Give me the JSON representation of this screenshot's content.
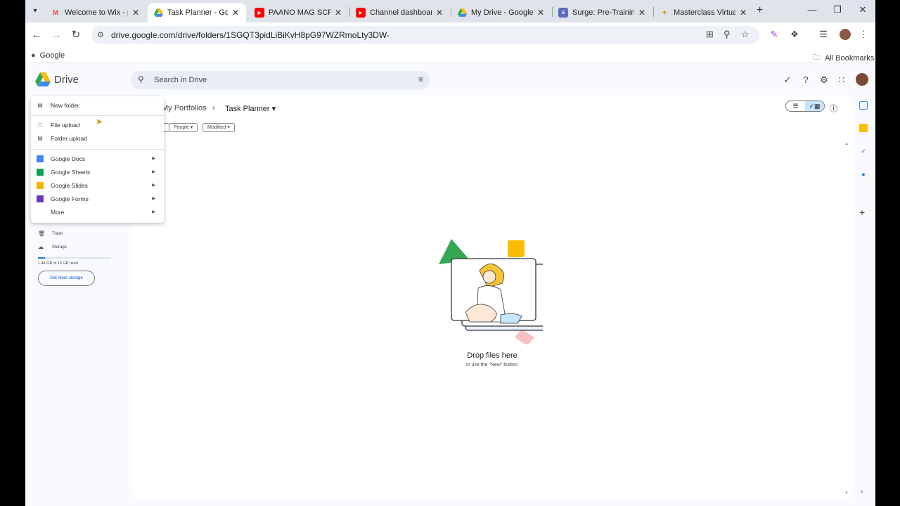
{
  "browser": {
    "tabs": [
      {
        "title": "Welcome to Wix - p",
        "favicon": "gmail-icon"
      },
      {
        "title": "Task Planner - Goog",
        "favicon": "drive-icon",
        "active": true
      },
      {
        "title": "PAANO MAG SCREEN",
        "favicon": "youtube-icon"
      },
      {
        "title": "Channel dashboard",
        "favicon": "youtube-icon"
      },
      {
        "title": "My Drive - Google D",
        "favicon": "drive-icon"
      },
      {
        "title": "Surge: Pre-Training",
        "favicon": "surge-icon"
      },
      {
        "title": "Masterclass Virtual A",
        "favicon": "masterclass-icon"
      }
    ],
    "url": "drive.google.com/drive/folders/1SGQT3pidLiBiKvH8pG97WZRmoLty3DW-",
    "bookmarks": {
      "google": "Google",
      "all": "All Bookmarks"
    }
  },
  "drive": {
    "app_name": "Drive",
    "search_placeholder": "Search in Drive",
    "breadcrumb": {
      "parent": "My Portfolios",
      "current": "Task Planner"
    },
    "filters": {
      "people": "People",
      "modified": "Modified"
    },
    "empty": {
      "title": "Drop files here",
      "subtitle": "or use the \"New\" button."
    },
    "sidebar": {
      "trash": "Trash",
      "storage": "Storage",
      "storage_used": "1.44 GB of 15 GB used",
      "storage_fraction": 0.096,
      "get_more": "Get more storage"
    },
    "new_menu": {
      "new_folder": "New folder",
      "file_upload": "File upload",
      "folder_upload": "Folder upload",
      "docs": "Google Docs",
      "sheets": "Google Sheets",
      "slides": "Google Slides",
      "forms": "Google Forms",
      "more": "More"
    }
  },
  "colors": {
    "docs": "#4285f4",
    "sheets": "#0f9d58",
    "slides": "#f4b400",
    "forms": "#673ab7",
    "accent": "#c2e7ff"
  }
}
